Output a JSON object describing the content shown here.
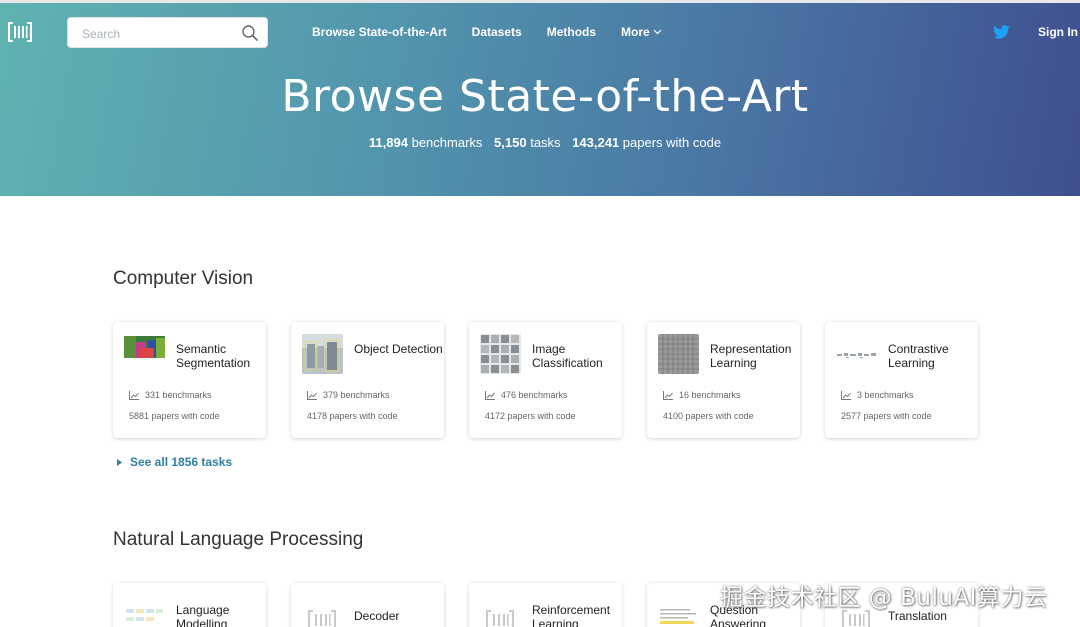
{
  "header": {
    "logo_icon": "paperswithcode-logo-icon",
    "search": {
      "placeholder": "Search",
      "value": "",
      "icon": "search-icon"
    },
    "nav": [
      {
        "label": "Browse State-of-the-Art"
      },
      {
        "label": "Datasets"
      },
      {
        "label": "Methods"
      },
      {
        "label": "More"
      }
    ],
    "twitter_icon": "twitter-icon",
    "sign_in": "Sign In"
  },
  "hero": {
    "title": "Browse State-of-the-Art",
    "stats": [
      {
        "value": "11,894",
        "label": "benchmarks"
      },
      {
        "value": "5,150",
        "label": "tasks"
      },
      {
        "value": "143,241",
        "label": "papers with code"
      }
    ]
  },
  "sections": [
    {
      "title": "Computer Vision",
      "cards": [
        {
          "name": "Semantic Segmentation",
          "benchmarks": "331 benchmarks",
          "papers": "5881 papers with code"
        },
        {
          "name": "Object Detection",
          "benchmarks": "379 benchmarks",
          "papers": "4178 papers with code"
        },
        {
          "name": "Image Classification",
          "benchmarks": "476 benchmarks",
          "papers": "4172 papers with code"
        },
        {
          "name": "Representation Learning",
          "benchmarks": "16 benchmarks",
          "papers": "4100 papers with code"
        },
        {
          "name": "Contrastive Learning",
          "benchmarks": "3 benchmarks",
          "papers": "2577 papers with code"
        }
      ],
      "see_all": "See all 1856 tasks"
    },
    {
      "title": "Natural Language Processing",
      "cards": [
        {
          "name": "Language Modelling"
        },
        {
          "name": "Decoder"
        },
        {
          "name": "Reinforcement Learning"
        },
        {
          "name": "Question Answering"
        },
        {
          "name": "Translation"
        }
      ]
    }
  ],
  "colors": {
    "accent_link": "#2e7fa5",
    "hero_gradient_start": "#5fb3b0",
    "hero_gradient_end": "#3f4f8f",
    "twitter_blue": "#1da1f2"
  },
  "watermark": "掘金技术社区 @ BuluAI算力云"
}
